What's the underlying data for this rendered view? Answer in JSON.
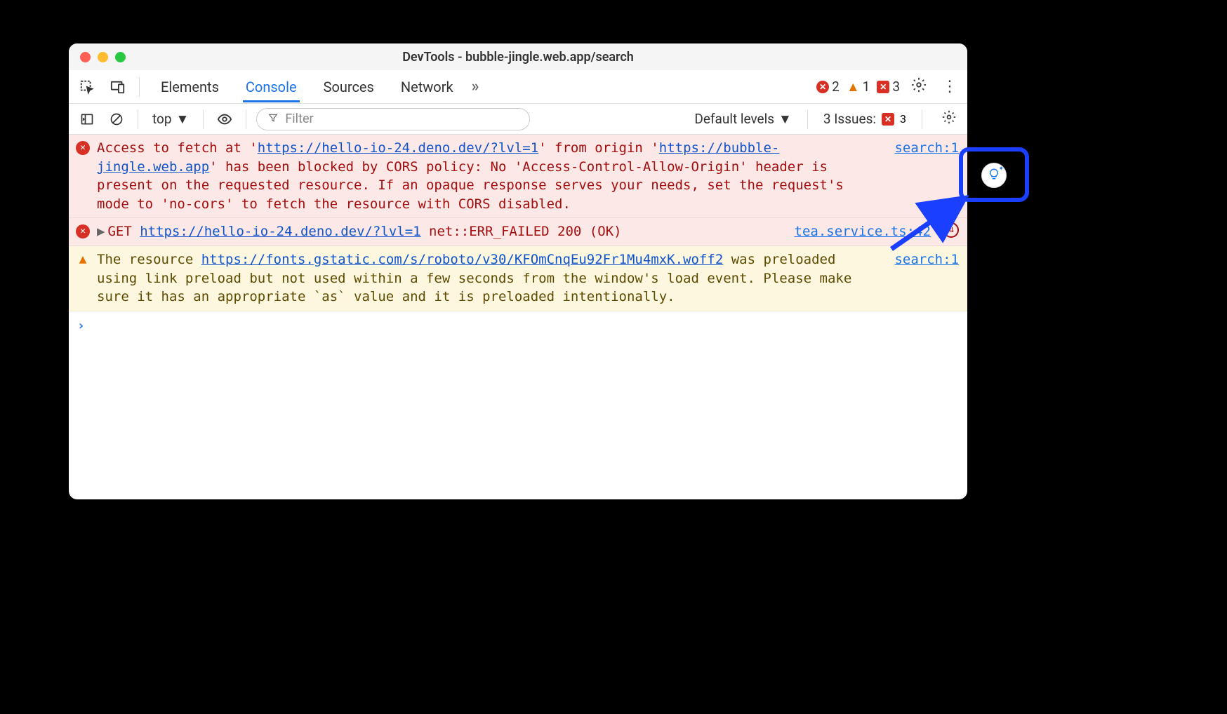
{
  "window": {
    "title": "DevTools - bubble-jingle.web.app/search"
  },
  "tabs": {
    "elements": "Elements",
    "console": "Console",
    "sources": "Sources",
    "network": "Network",
    "overflow": "»"
  },
  "badges": {
    "errors": "2",
    "warnings": "1",
    "issues": "3"
  },
  "toolbar": {
    "context": "top",
    "filter_placeholder": "Filter",
    "levels": "Default levels",
    "issues_label": "3 Issues:",
    "issues_count": "3"
  },
  "messages": {
    "m1": {
      "pre1": "Access to fetch at '",
      "link1": "https://hello-io-24.deno.dev/?lvl=1",
      "mid1": "' from origin '",
      "link2": "https://bubble-jingle.web.app",
      "post1": "' has been blocked by CORS policy: No 'Access-Control-Allow-Origin' header is present on the requested resource. If an opaque response serves your needs, set the request's mode to 'no-cors' to fetch the resource with CORS disabled.",
      "source": "search:1"
    },
    "m2": {
      "pre": "GET ",
      "link": "https://hello-io-24.deno.dev/?lvl=1",
      "post": " net::ERR_FAILED 200 (OK)",
      "source": "tea.service.ts:42"
    },
    "m3": {
      "pre": "The resource ",
      "link": "https://fonts.gstatic.com/s/roboto/v30/KFOmCnqEu92Fr1Mu4mxK.woff2",
      "post": " was preloaded using link preload but not used within a few seconds from the window's load event. Please make sure it has an appropriate `as` value and it is preloaded intentionally.",
      "source": "search:1"
    }
  }
}
